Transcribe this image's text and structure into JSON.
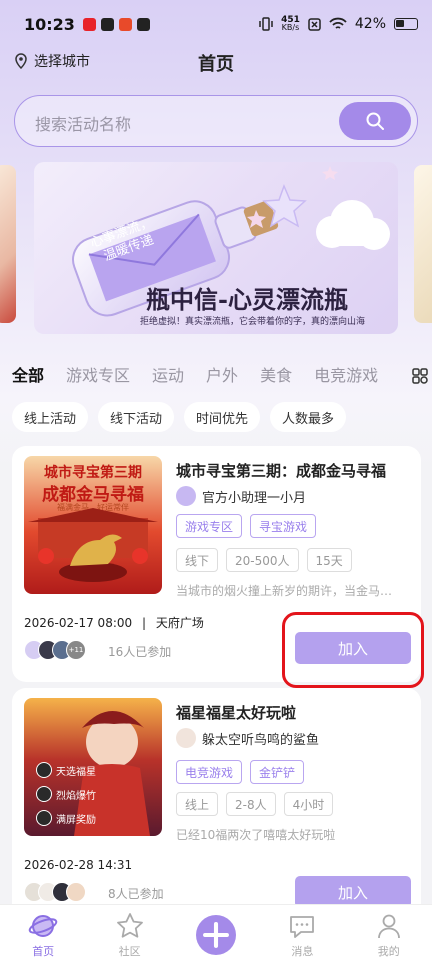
{
  "status_bar": {
    "time": "10:23",
    "net_speed_value": "451",
    "net_speed_unit": "KB/s",
    "battery": "42%"
  },
  "header": {
    "city_label": "选择城市",
    "title": "首页"
  },
  "search": {
    "placeholder": "搜索活动名称"
  },
  "banner": {
    "title": "瓶中信-心灵漂流瓶",
    "subtitle": "拒绝虚拟！真实漂流瓶，它会带着你的字，真的漂向山海",
    "letter_line1": "心事漂流，",
    "letter_line2": "温暖传递"
  },
  "categories": [
    "全部",
    "游戏专区",
    "运动",
    "户外",
    "美食",
    "电竞游戏"
  ],
  "filters": [
    "线上活动",
    "线下活动",
    "时间优先",
    "人数最多"
  ],
  "activities": [
    {
      "title": "城市寻宝第三期：成都金马寻福",
      "organizer": "官方小助理一小月",
      "thumb_title": "城市寻宝第三期",
      "thumb_subtitle": "成都金马寻福",
      "thumb_slogan": "福满金马，好运常伴",
      "tags": [
        "游戏专区",
        "寻宝游戏"
      ],
      "info_tags": [
        "线下",
        "20-500人",
        "15天"
      ],
      "description": "当城市的烟火撞上新岁的期许，当金马…",
      "datetime": "2026-02-17 08:00",
      "separator": "|",
      "location": "天府广场",
      "avatar_more": "+11",
      "joined": "16人已参加",
      "join_label": "加入"
    },
    {
      "title": "福星福星太好玩啦",
      "organizer": "躲太空听鸟鸣的鲨鱼",
      "thumb_lines": [
        "天选福星",
        "烈焰爆竹",
        "满屏奖励"
      ],
      "tags": [
        "电竞游戏",
        "金铲铲"
      ],
      "info_tags": [
        "线上",
        "2-8人",
        "4小时"
      ],
      "description": "已经10福两次了嘻嘻太好玩啦",
      "datetime": "2026-02-28 14:31",
      "joined": "8人已参加",
      "join_label": "加入"
    }
  ],
  "tabbar": [
    {
      "label": "首页",
      "icon": "home-planet-icon",
      "active": true
    },
    {
      "label": "社区",
      "icon": "star-icon"
    },
    {
      "label": "",
      "icon": "plus-icon"
    },
    {
      "label": "消息",
      "icon": "message-icon"
    },
    {
      "label": "我的",
      "icon": "profile-icon"
    }
  ],
  "colors": {
    "accent": "#a48ae9",
    "annotation": "#e3141b"
  }
}
